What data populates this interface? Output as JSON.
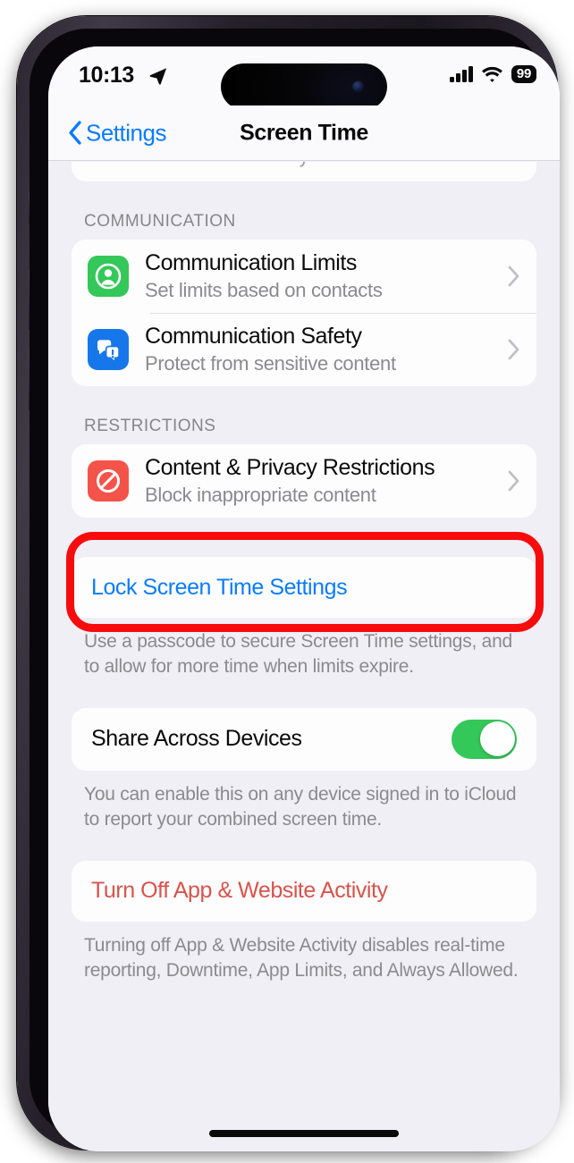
{
  "status_bar": {
    "time": "10:13",
    "location_icon": "location-arrow-icon",
    "cellular_icon": "cellular-bars-icon",
    "wifi_icon": "wifi-icon",
    "battery_level": "99"
  },
  "nav_bar": {
    "back_label": "Settings",
    "back_chevron": "chevron-left-icon",
    "title": "Screen Time"
  },
  "colors": {
    "accent_blue": "#0a7cff",
    "destructive_red": "#d9534c",
    "highlight_ring": "#f60c0c",
    "toggle_on_green": "#34c759",
    "icon_green": "#34c759",
    "icon_blue": "#1677ea",
    "icon_red": "#f4534a",
    "screen_background": "#f0eff5",
    "card_background": "#fdfdfd"
  },
  "sections": {
    "communication": {
      "header": "COMMUNICATION",
      "rows": [
        {
          "title": "Communication Limits",
          "subtitle": "Set limits based on contacts",
          "icon": "person-in-circle-icon",
          "accessory": "chevron-right-icon"
        },
        {
          "title": "Communication Safety",
          "subtitle": "Protect from sensitive content",
          "icon": "speech-bubbles-alert-icon",
          "accessory": "chevron-right-icon"
        }
      ]
    },
    "restrictions": {
      "header": "RESTRICTIONS",
      "rows": [
        {
          "title": "Content & Privacy Restrictions",
          "subtitle": "Block inappropriate content",
          "icon": "no-entry-icon",
          "accessory": "chevron-right-icon",
          "highlighted": "true"
        }
      ]
    },
    "lock_settings": {
      "label": "Lock Screen Time Settings",
      "footer": "Use a passcode to secure Screen Time settings, and to allow for more time when limits expire."
    },
    "share_across_devices": {
      "label": "Share Across Devices",
      "toggle_state": "on",
      "footer": "You can enable this on any device signed in to iCloud to report your combined screen time."
    },
    "turn_off_activity": {
      "label": "Turn Off App & Website Activity",
      "footer": "Turning off App & Website Activity disables real-time reporting, Downtime, App Limits, and Always Allowed."
    }
  },
  "home_indicator": "home-indicator-bar"
}
